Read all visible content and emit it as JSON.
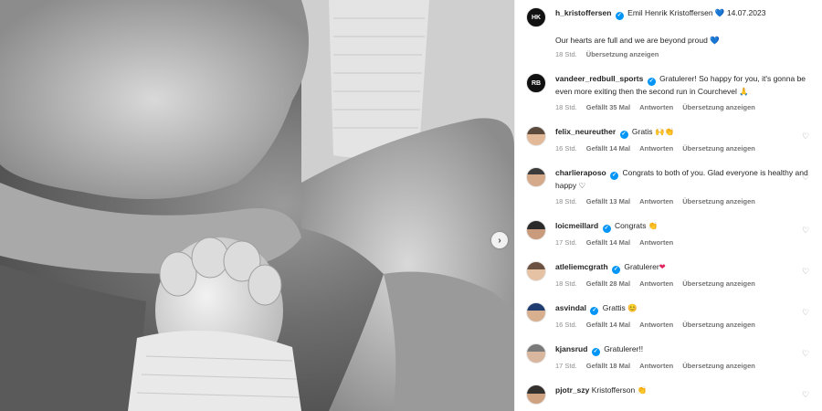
{
  "post": {
    "username": "h_kristoffersen",
    "avatar_text": "HK",
    "author_name": "Emil Henrik Kristoffersen",
    "date": "14.07.2023",
    "caption": "Our hearts are full and we are beyond proud",
    "age": "18 Std.",
    "translate": "Übersetzung anzeigen"
  },
  "comments": [
    {
      "username": "vandeer_redbull_sports",
      "text": "Gratulerer! So happy for you, it's gonna be even more exiting then the second run in Courchevel",
      "emoji": "🙏",
      "age": "18 Std.",
      "likes": "Gefällt 35 Mal",
      "reply": "Antworten",
      "translate": "Übersetzung anzeigen"
    },
    {
      "username": "felix_neureuther",
      "text": "Gratis",
      "emoji": "🙌👏",
      "age": "16 Std.",
      "likes": "Gefällt 14 Mal",
      "reply": "Antworten",
      "translate": "Übersetzung anzeigen"
    },
    {
      "username": "charlieraposo",
      "text": "Congrats to both of you. Glad everyone is healthy and happy",
      "emoji": "♡",
      "age": "18 Std.",
      "likes": "Gefällt 13 Mal",
      "reply": "Antworten",
      "translate": "Übersetzung anzeigen"
    },
    {
      "username": "loicmeillard",
      "text": "Congrats",
      "emoji": "👏",
      "age": "17 Std.",
      "likes": "Gefällt 14 Mal",
      "reply": "Antworten",
      "translate": ""
    },
    {
      "username": "atleliemcgrath",
      "text": "Gratulerer",
      "emoji": "❤",
      "age": "18 Std.",
      "likes": "Gefällt 28 Mal",
      "reply": "Antworten",
      "translate": "Übersetzung anzeigen"
    },
    {
      "username": "asvindal",
      "text": "Grattis",
      "emoji": "😊",
      "age": "16 Std.",
      "likes": "Gefällt 14 Mal",
      "reply": "Antworten",
      "translate": "Übersetzung anzeigen"
    },
    {
      "username": "kjansrud",
      "text": "Gratulerer!!",
      "emoji": "",
      "age": "17 Std.",
      "likes": "Gefällt 18 Mal",
      "reply": "Antworten",
      "translate": "Übersetzung anzeigen"
    },
    {
      "username": "pjotr_szy",
      "text": "Kristofferson",
      "emoji": "👏",
      "age": "",
      "likes": "",
      "reply": "",
      "translate": ""
    }
  ],
  "colors": {
    "verified": "#0095f6",
    "muted": "#8e8e8e",
    "text": "#262626"
  }
}
